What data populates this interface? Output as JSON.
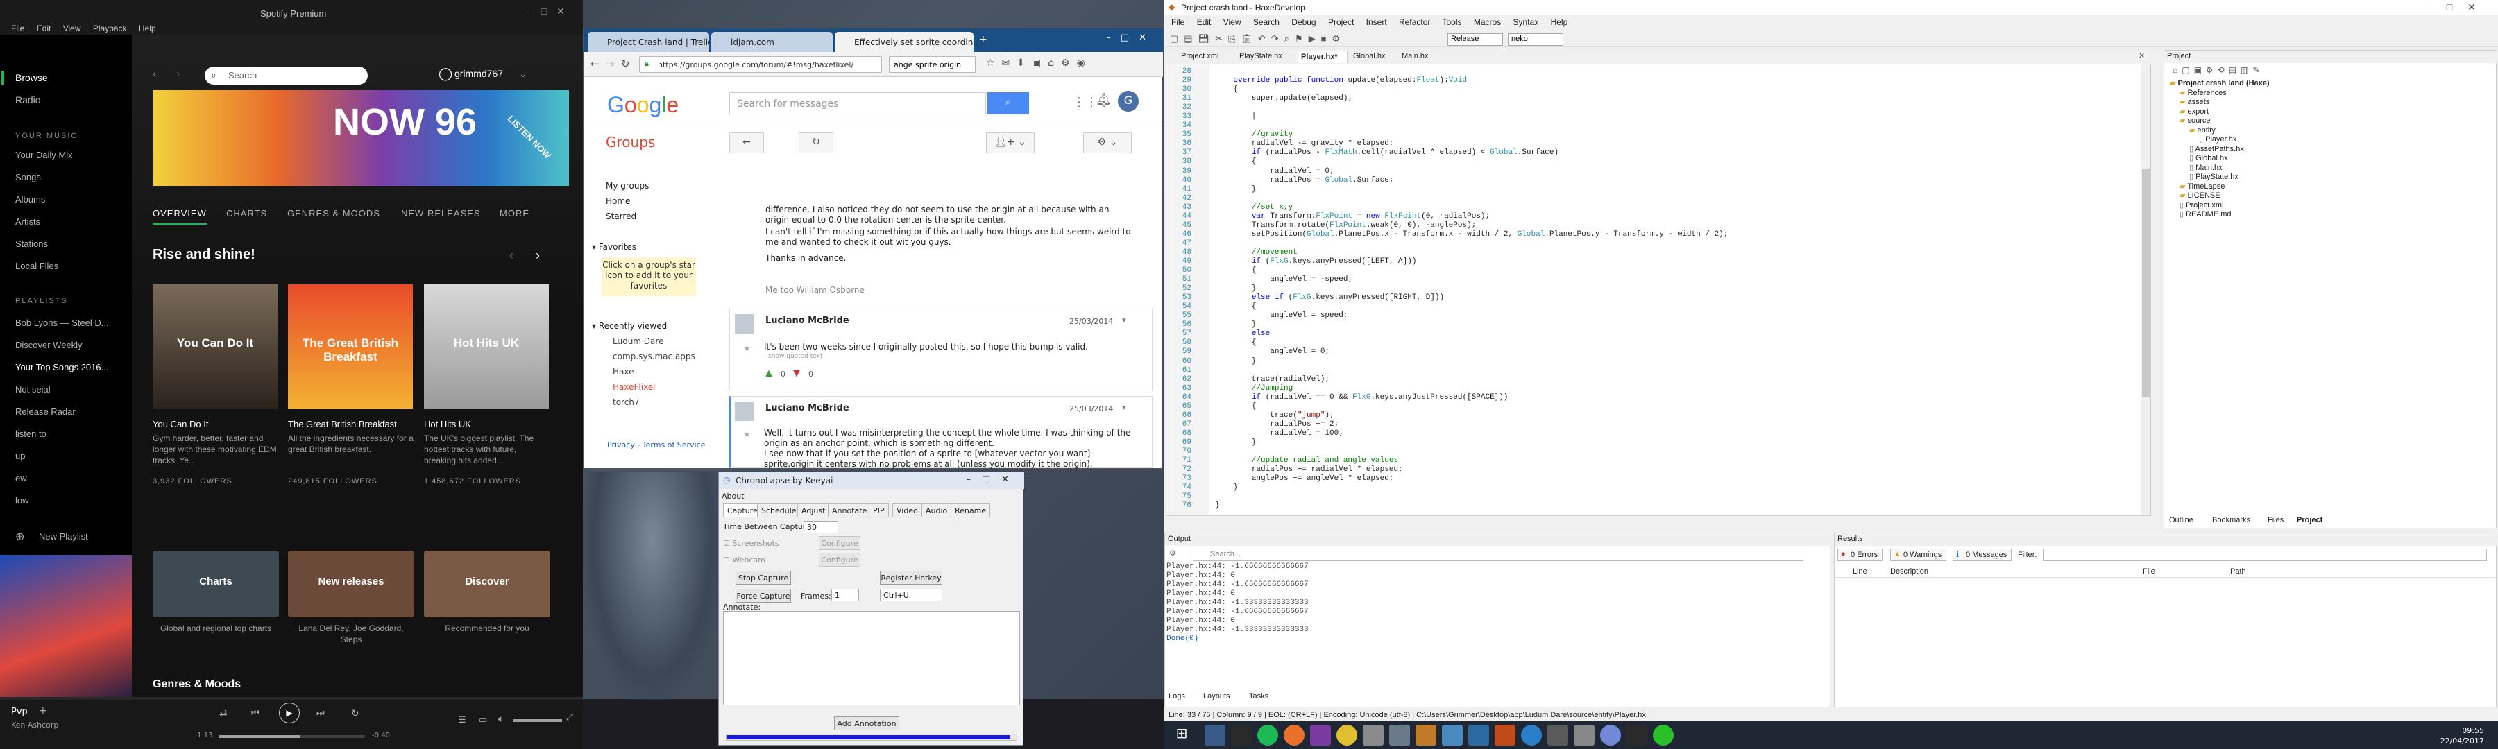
{
  "spotify": {
    "window_title": "Spotify Premium",
    "menu": [
      "File",
      "Edit",
      "View",
      "Playback",
      "Help"
    ],
    "nav": [
      "Browse",
      "Radio"
    ],
    "your_music_heading": "YOUR MUSIC",
    "your_music": [
      "Your Daily Mix",
      "Songs",
      "Albums",
      "Artists",
      "Stations",
      "Local Files"
    ],
    "playlists_heading": "PLAYLISTS",
    "playlists": [
      "Bob Lyons — Steel D...",
      "Discover Weekly",
      "Your Top Songs 2016...",
      "Not seial",
      "Release Radar",
      "listen to",
      "up",
      "ew",
      "low"
    ],
    "new_playlist": "New Playlist",
    "search_placeholder": "Search",
    "username": "grimmd767",
    "banner_text": "NOW 96",
    "banner_badge": "LISTEN NOW",
    "tabs": [
      "OVERVIEW",
      "CHARTS",
      "GENRES & MOODS",
      "NEW RELEASES",
      "MORE"
    ],
    "section_title": "Rise and shine!",
    "cards": [
      {
        "art": "You Can Do It",
        "title": "You Can Do It",
        "desc": "Gym harder, better, faster and longer with these motivating EDM tracks. Ye...",
        "followers": "3,932 FOLLOWERS"
      },
      {
        "art": "The Great British Breakfast",
        "title": "The Great British Breakfast",
        "desc": "All the ingredients necessary for a great British breakfast.",
        "followers": "249,815 FOLLOWERS"
      },
      {
        "art": "Hot Hits UK",
        "title": "Hot Hits UK",
        "desc": "The UK's biggest playlist. The hottest tracks with future, breaking hits added...",
        "followers": "1,458,672 FOLLOWERS"
      }
    ],
    "genre_cards": [
      {
        "label": "Charts",
        "desc": "Global and regional top charts"
      },
      {
        "label": "New releases",
        "desc": "Lana Del Rey, Joe Goddard, Steps"
      },
      {
        "label": "Discover",
        "desc": "Recommended for you"
      }
    ],
    "genres_heading": "Genres & Moods",
    "now_playing_title": "Pvp",
    "now_playing_artist": "Ken Ashcorp",
    "elapsed": "1:13",
    "remaining": "-0:40"
  },
  "chrome": {
    "tabs": [
      "Project Crash land | Trello",
      "ldjam.com",
      "Effectively set sprite coordin..."
    ],
    "url": "https://groups.google.com/forum/#!msg/haxeflixel/",
    "find_text": "ange sprite origin",
    "search_placeholder": "Search for messages",
    "groups_title": "Groups",
    "nav": [
      "My groups",
      "Home",
      "Starred"
    ],
    "favorites_heading": "Favorites",
    "favorites_hint": "Click on a group's star icon to add it to your favorites",
    "recent_heading": "Recently viewed",
    "recent": [
      "Ludum Dare",
      "comp.sys.mac.apps",
      "Haxe",
      "HaxeFlixel",
      "torch7"
    ],
    "footer": "Privacy - Terms of Service",
    "post_intro": "difference. I also noticed they do not seem to use the origin at all because with an origin equal to 0.0 the rotation center is the sprite center.",
    "post_intro2": "I can't tell if I'm missing something or if this actually how things are but seems weird to me and wanted to check it out wit you guys.",
    "post_thanks": "Thanks in advance.",
    "me_too": "Me too   William Osborne",
    "posts": [
      {
        "author": "Luciano McBride",
        "date": "25/03/2014",
        "body": "It's been two weeks since I originally posted this, so I hope this bump is valid.",
        "quoted": "- show quoted text -",
        "up": "0",
        "down": "0"
      },
      {
        "author": "Luciano McBride",
        "date": "25/03/2014",
        "body": "Well, it turns out I was misinterpreting the concept the whole time. I was thinking of the origin as an anchor point, which is something different.",
        "body2": "I see now that if you set the position of a sprite to [whatever vector you want]-sprite.origin it centers with no problems at all (unless you modify it the origin)."
      }
    ]
  },
  "chrono": {
    "title": "ChronoLapse by Keeyai",
    "menu": "About",
    "tabs": [
      "Capture",
      "Schedule",
      "Adjust",
      "Annotate",
      "PIP",
      "Video",
      "Audio",
      "Rename"
    ],
    "time_between": "Time Between Captures:",
    "time_value": "30",
    "screenshots": "Screenshots",
    "webcam": "Webcam",
    "configure": "Configure",
    "stop": "Stop Capture",
    "force": "Force Capture",
    "frames_label": "Frames:",
    "frames_value": "1",
    "register": "Register Hotkey",
    "hotkey": "Ctrl+U",
    "annotate_label": "Annotate:",
    "add_annotation": "Add Annotation",
    "progress": 0.98
  },
  "haxe": {
    "title": "Project crash land - HaxeDevelop",
    "menu": [
      "File",
      "Edit",
      "View",
      "Search",
      "Debug",
      "Project",
      "Insert",
      "Refactor",
      "Tools",
      "Macros",
      "Syntax",
      "Help"
    ],
    "config": "Release",
    "target": "neko",
    "file_tabs": [
      "Project.xml",
      "PlayState.hx",
      "Player.hx*",
      "Global.hx",
      "Main.hx"
    ],
    "first_line": 28,
    "code": [
      "",
      "    override public function update(elapsed:Float):Void",
      "    {",
      "        super.update(elapsed);",
      "",
      "        |",
      "",
      "        //gravity",
      "        radialVel -= gravity * elapsed;",
      "        if (radialPos - FlxMath.cell(radialVel * elapsed) < Global.Surface)",
      "        {",
      "            radialVel = 0;",
      "            radialPos = Global.Surface;",
      "        }",
      "",
      "        //set x,y",
      "        var Transform:FlxPoint = new FlxPoint(0, radialPos);",
      "        Transform.rotate(FlxPoint.weak(0, 0), -anglePos);",
      "        setPosition(Global.PlanetPos.x - Transform.x - width / 2, Global.PlanetPos.y - Transform.y - width / 2);",
      "",
      "        //movement",
      "        if (FlxG.keys.anyPressed([LEFT, A]))",
      "        {",
      "            angleVel = -speed;",
      "        }",
      "        else if (FlxG.keys.anyPressed([RIGHT, D]))",
      "        {",
      "            angleVel = speed;",
      "        }",
      "        else",
      "        {",
      "            angleVel = 0;",
      "        }",
      "",
      "        trace(radialVel);",
      "        //Jumping",
      "        if (radialVel == 0 && FlxG.keys.anyJustPressed([SPACE]))",
      "        {",
      "            trace(\"jump\");",
      "            radialPos += 2;",
      "            radialVel = 100;",
      "        }",
      "",
      "        //update radial and angle values",
      "        radialPos += radialVel * elapsed;",
      "        anglePos += angleVel * elapsed;",
      "    }",
      "",
      "}"
    ],
    "project_title": "Project",
    "tree": [
      {
        "label": "Project crash land (Haxe)",
        "depth": 0,
        "bold": true
      },
      {
        "label": "References",
        "depth": 1
      },
      {
        "label": "assets",
        "depth": 1
      },
      {
        "label": "export",
        "depth": 1
      },
      {
        "label": "source",
        "depth": 1
      },
      {
        "label": "entity",
        "depth": 2
      },
      {
        "label": "Player.hx",
        "depth": 3
      },
      {
        "label": "AssetPaths.hx",
        "depth": 2
      },
      {
        "label": "Global.hx",
        "depth": 2
      },
      {
        "label": "Main.hx",
        "depth": 2
      },
      {
        "label": "PlayState.hx",
        "depth": 2
      },
      {
        "label": "TimeLapse",
        "depth": 1
      },
      {
        "label": "LICENSE",
        "depth": 1
      },
      {
        "label": "Project.xml",
        "depth": 1
      },
      {
        "label": "README.md",
        "depth": 1
      }
    ],
    "panel_tabs": [
      "Outline",
      "Bookmarks",
      "Files",
      "Project"
    ],
    "output_title": "Output",
    "output_search": "Search...",
    "output_lines": [
      "Player.hx:44: -1.66666666666667",
      "Player.hx:44: 0",
      "Player.hx:44: -1.66666666666667",
      "Player.hx:44: 0",
      "Player.hx:44: -1.33333333333333",
      "Player.hx:44: -1.66666666666667",
      "Player.hx:44: 0",
      "Player.hx:44: -1.33333333333333",
      "Done(0)"
    ],
    "results_title": "Results",
    "errors": "0 Errors",
    "warnings": "0 Warnings",
    "messages": "0 Messages",
    "filter": "Filter:",
    "result_columns": [
      "Line",
      "Description",
      "File",
      "Path"
    ],
    "bottom_tabs": [
      "Logs",
      "Layouts",
      "Tasks"
    ],
    "status": "Line: 33 / 75  |  Column: 9 / 9  |  EOL: (CR+LF)  |  Encoding: Unicode (utf-8)  |  C:\\Users\\Grimmer\\Desktop\\app\\Ludum Dare\\source\\entity\\Player.hx"
  },
  "taskbar": {
    "time": "09:55",
    "date": "22/04/2017"
  }
}
